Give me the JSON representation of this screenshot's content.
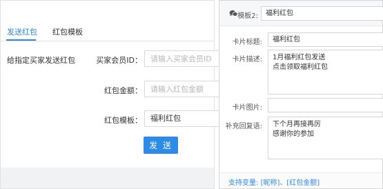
{
  "left": {
    "tabs": [
      {
        "label": "发送红包",
        "active": true
      },
      {
        "label": "红包模板",
        "active": false
      }
    ],
    "description": "给指定买家发送红包",
    "fields": {
      "buyer_id": {
        "label": "买家会员ID：",
        "placeholder": "请输入买家会员ID"
      },
      "amount": {
        "label": "红包金额：",
        "placeholder": "请输入红包金额"
      },
      "template": {
        "label": "红包模板：",
        "value": "福利红包"
      }
    },
    "send_button": "发 送"
  },
  "right": {
    "template": {
      "label": "模板2:",
      "value": "福利红包"
    },
    "card_title": {
      "label": "卡片标题:",
      "value": "福利红包"
    },
    "card_desc": {
      "label": "卡片描述:",
      "lines": [
        "1月福利红包发送",
        "点击领取福利红包"
      ]
    },
    "card_image": {
      "label": "卡片图片:",
      "value": ""
    },
    "extra_reply": {
      "label": "补充回复语:",
      "lines": [
        "下个月再接再厉",
        "感谢你的参加"
      ]
    },
    "variables": {
      "prefix": "支持变量: ",
      "items": [
        "[昵称]",
        "[红包金额]"
      ],
      "separator": "、"
    }
  },
  "colors": {
    "accent": "#2d8ae5",
    "header_bg": "#f6f7f9",
    "footer_bg": "#f1f2f4"
  }
}
